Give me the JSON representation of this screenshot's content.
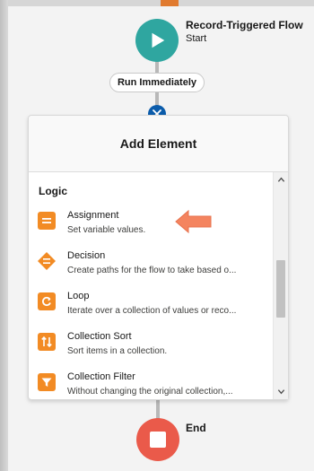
{
  "start": {
    "title": "Record-Triggered Flow",
    "subtitle": "Start"
  },
  "run_pill": {
    "label": "Run Immediately"
  },
  "panel": {
    "title": "Add Element",
    "section": "Logic",
    "items": [
      {
        "name": "Assignment",
        "description": "Set variable values.",
        "icon": "equals-icon"
      },
      {
        "name": "Decision",
        "description": "Create paths for the flow to take based o...",
        "icon": "decision-icon"
      },
      {
        "name": "Loop",
        "description": "Iterate over a collection of values or reco...",
        "icon": "loop-icon"
      },
      {
        "name": "Collection Sort",
        "description": "Sort items in a collection.",
        "icon": "sort-icon"
      },
      {
        "name": "Collection Filter",
        "description": "Without changing the original collection,...",
        "icon": "filter-icon"
      }
    ]
  },
  "end": {
    "label": "End"
  },
  "colors": {
    "start": "#2fa6a0",
    "end": "#ea5a4a",
    "accent": "#f28b24",
    "close": "#0b5cab"
  }
}
